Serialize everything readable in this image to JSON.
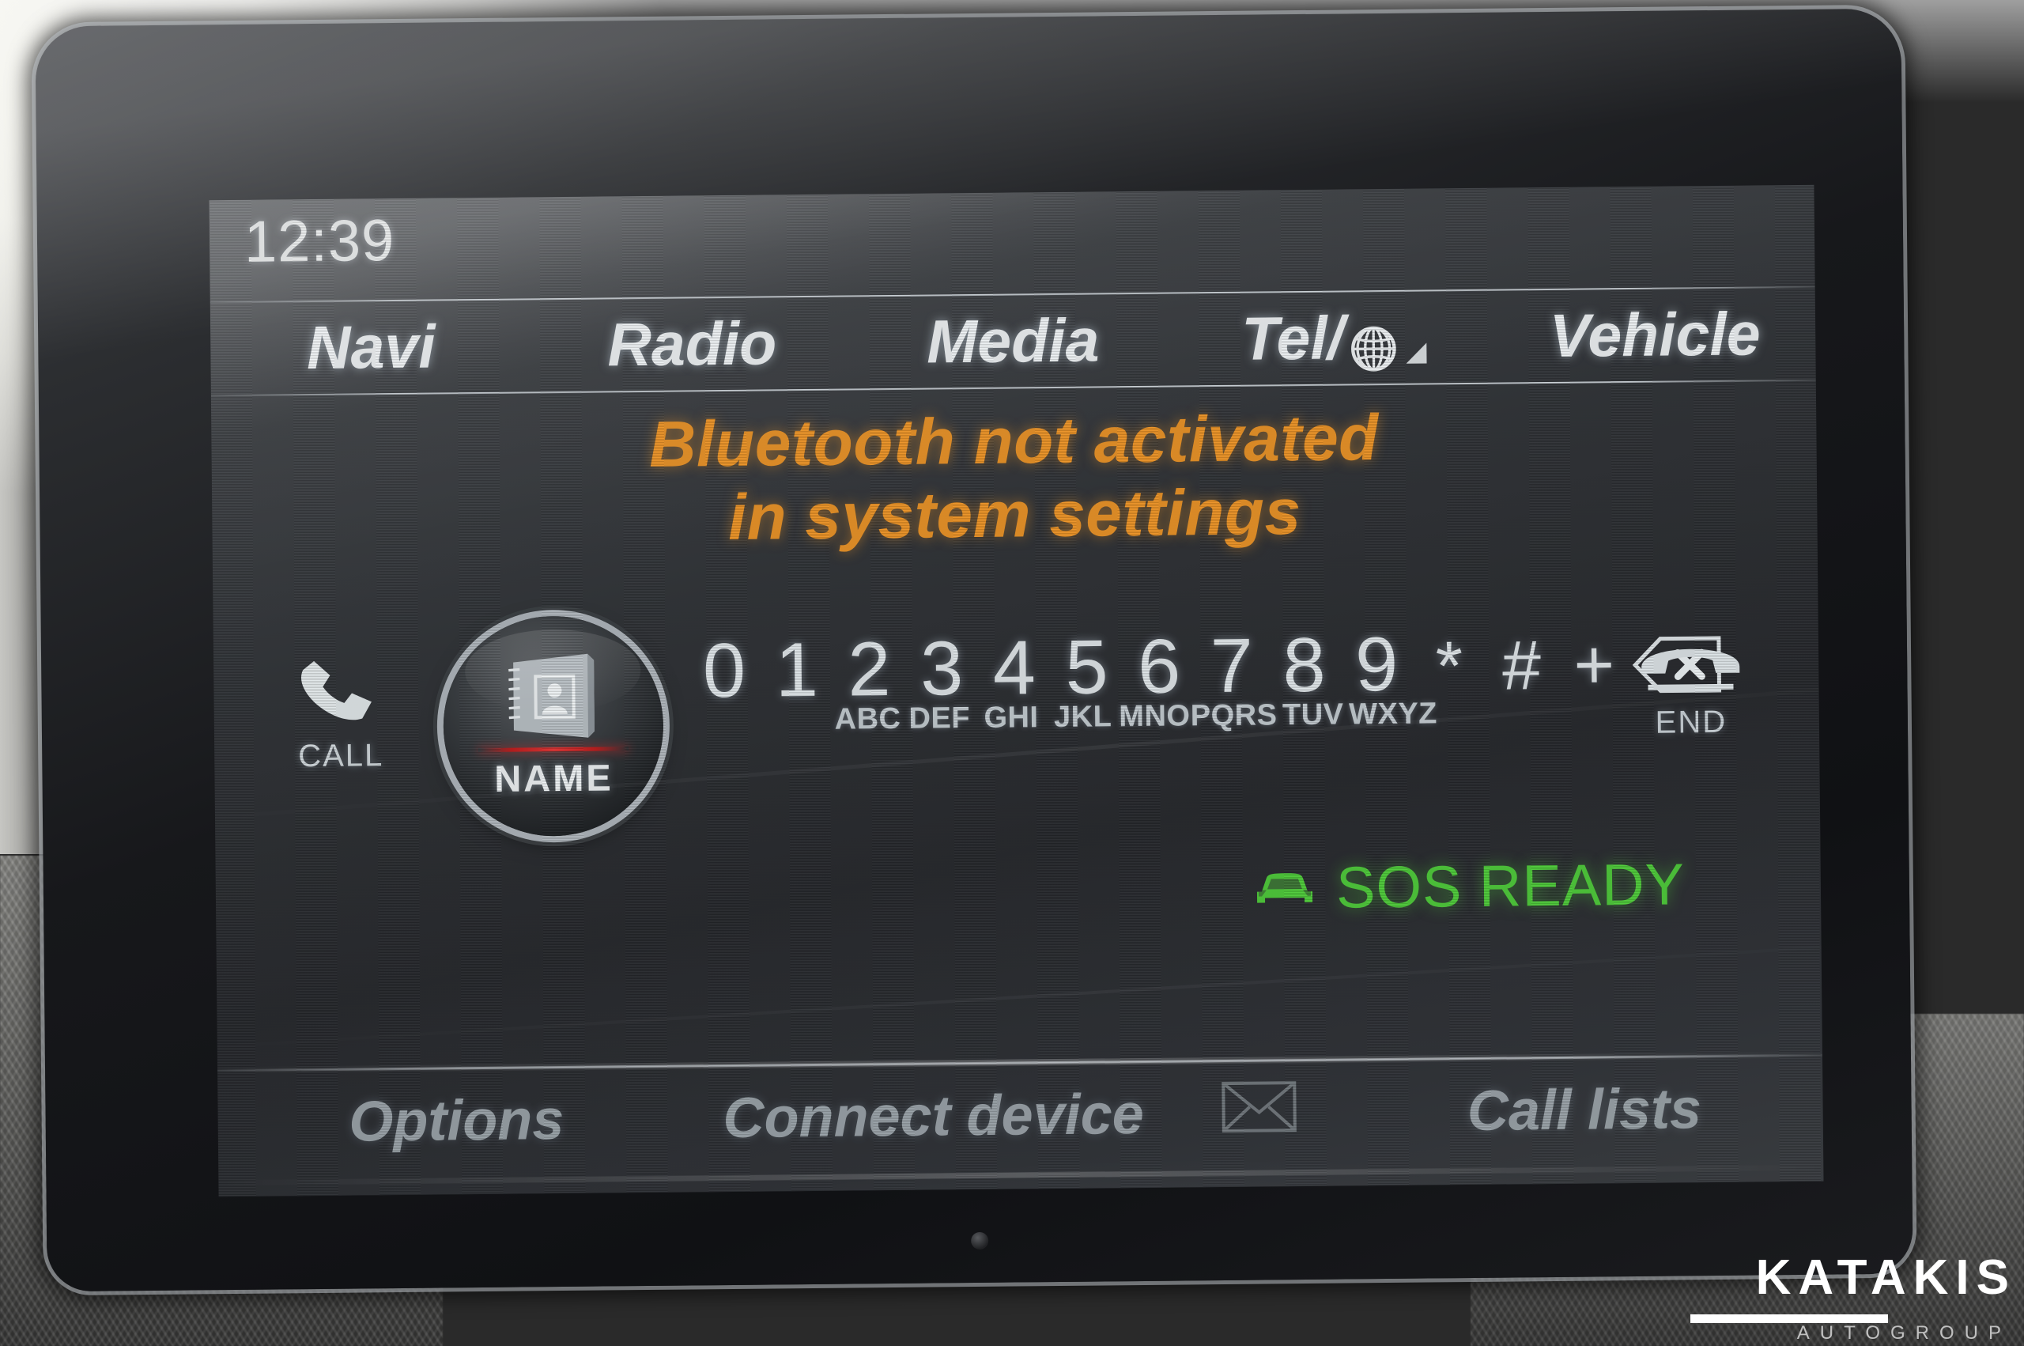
{
  "device": {
    "brand_overlay": "KATAKIS",
    "brand_overlay_sub": "AUTOGROUP"
  },
  "status_bar": {
    "clock": "12:39"
  },
  "menu_bar": {
    "items": [
      {
        "label": "Navi",
        "icon": ""
      },
      {
        "label": "Radio",
        "icon": ""
      },
      {
        "label": "Media",
        "icon": ""
      },
      {
        "label": "Tel/",
        "icon": "globe-icon",
        "signal_icon": "signal-triangle-icon",
        "selected": true
      },
      {
        "label": "Vehicle",
        "icon": ""
      }
    ]
  },
  "notification": {
    "line1": "Bluetooth not activated",
    "line2": "in system settings",
    "color": "#eb9326"
  },
  "phone": {
    "call_button": {
      "label": "CALL",
      "icon": "phone-handset-icon"
    },
    "name_button": {
      "label": "NAME",
      "icon": "address-book-icon",
      "accent_color": "#c01b1b"
    },
    "end_button": {
      "label": "END",
      "icon": "phone-hangup-icon"
    },
    "keypad": {
      "keys": [
        {
          "digit": "0",
          "letters": ""
        },
        {
          "digit": "1",
          "letters": ""
        },
        {
          "digit": "2",
          "letters": "ABC"
        },
        {
          "digit": "3",
          "letters": "DEF"
        },
        {
          "digit": "4",
          "letters": "GHI"
        },
        {
          "digit": "5",
          "letters": "JKL"
        },
        {
          "digit": "6",
          "letters": "MNO"
        },
        {
          "digit": "7",
          "letters": "PQRS"
        },
        {
          "digit": "8",
          "letters": "TUV"
        },
        {
          "digit": "9",
          "letters": "WXYZ"
        },
        {
          "digit": "*",
          "letters": ""
        },
        {
          "digit": "#",
          "letters": ""
        },
        {
          "digit": "+",
          "letters": ""
        }
      ],
      "backspace": {
        "icon": "backspace-icon",
        "glyph": "x"
      }
    }
  },
  "sos": {
    "label": "SOS READY",
    "icon": "car-icon",
    "color": "#4ecb3a"
  },
  "bottom_bar": {
    "items": [
      {
        "label": "Options",
        "icon": ""
      },
      {
        "label": "Connect device",
        "icon": ""
      },
      {
        "label": "",
        "icon": "envelope-icon"
      },
      {
        "label": "Call lists",
        "icon": ""
      }
    ]
  }
}
